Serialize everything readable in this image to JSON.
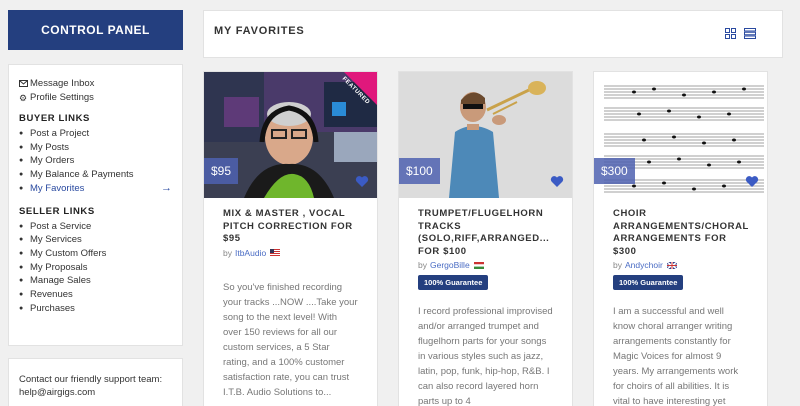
{
  "control_panel": {
    "title": "CONTROL PANEL"
  },
  "sidebar": {
    "top_links": [
      {
        "label": "Message Inbox",
        "icon": "envelope-icon"
      },
      {
        "label": "Profile Settings",
        "icon": "gear-icon"
      }
    ],
    "buyer_title": "BUYER LINKS",
    "buyer_links": [
      "Post a Project",
      "My Posts",
      "My Orders",
      "My Balance & Payments",
      "My Favorites"
    ],
    "buyer_active": "My Favorites",
    "seller_title": "SELLER LINKS",
    "seller_links": [
      "Post a Service",
      "My Services",
      "My Custom Offers",
      "My Proposals",
      "Manage Sales",
      "Revenues",
      "Purchases"
    ]
  },
  "support": {
    "text": "Contact our friendly support team:",
    "email": "help@airgigs.com"
  },
  "main": {
    "title": "MY FAVORITES",
    "view_icons": [
      "grid-view-icon",
      "list-view-icon"
    ]
  },
  "colors": {
    "brand": "#243f7f",
    "link": "#4a6cc4",
    "price_bg": "#4f62b0"
  },
  "cards": [
    {
      "price": "$95",
      "title": "MIX & MASTER , VOCAL PITCH CORRECTION FOR $95",
      "by": "by",
      "author": "ItbAudio",
      "flag": "us-flag-icon",
      "guarantee": "",
      "badge": "FEATURED",
      "description": "So you've finished recording your tracks ...NOW ....Take your song to the next level! With over 150 reviews for all our custom services, a 5 Star rating, and a 100% customer satisfaction rate, you can trust I.T.B. Audio Solutions to..."
    },
    {
      "price": "$100",
      "title": "TRUMPET/FLUGELHORN TRACKS (SOLO,RIFF,ARRANGED... FOR $100",
      "by": "by",
      "author": "GergoBille",
      "flag": "hungary-flag-icon",
      "guarantee": "100% Guarantee",
      "badge": "",
      "description": "I record professional improvised and/or arranged trumpet and flugelhorn parts for your songs in various styles such as jazz, latin, pop, funk, hip-hop, R&B. I can also record layered horn parts up to 4"
    },
    {
      "price": "$300",
      "title": "CHOIR ARRANGEMENTS/CHORAL ARRANGEMENTS FOR $300",
      "by": "by",
      "author": "Andychoir",
      "flag": "uk-flag-icon",
      "guarantee": "100% Guarantee",
      "badge": "",
      "description": "I am a successful and well know choral arranger writing arrangements constantly for Magic Voices for almost 9 years. My arrangements work for choirs of all abilities. It is vital to have interesting yet"
    }
  ]
}
